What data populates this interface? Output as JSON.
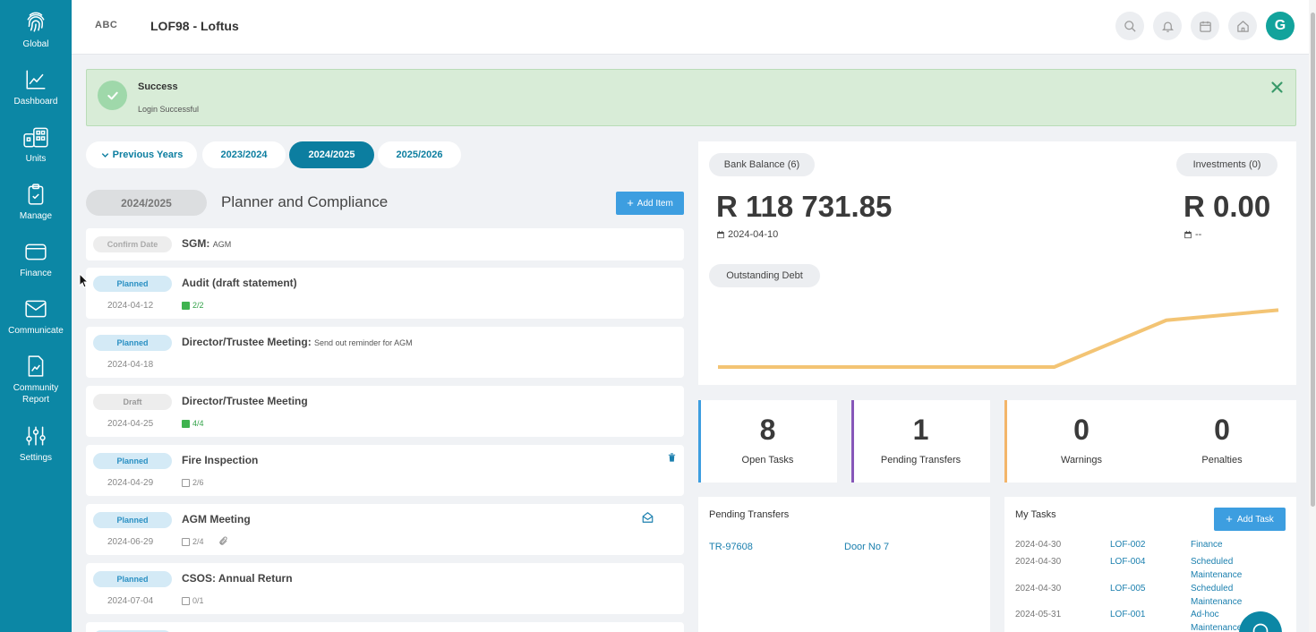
{
  "sidebar": {
    "items": [
      {
        "label": "Global",
        "icon": "fingerprint-icon"
      },
      {
        "label": "Dashboard",
        "icon": "chart-line-icon"
      },
      {
        "label": "Units",
        "icon": "buildings-icon"
      },
      {
        "label": "Manage",
        "icon": "clipboard-check-icon"
      },
      {
        "label": "Finance",
        "icon": "wallet-icon"
      },
      {
        "label": "Communicate",
        "icon": "envelope-icon"
      },
      {
        "label": "Community",
        "label2": "Report",
        "icon": "report-icon"
      },
      {
        "label": "Settings",
        "icon": "sliders-icon"
      }
    ]
  },
  "header": {
    "logo": "ABC",
    "title": "LOF98 - Loftus",
    "avatar_initial": "G",
    "accent": "#0c87a5"
  },
  "alert": {
    "title": "Success",
    "message": "Login Successful"
  },
  "year_tabs": [
    {
      "label": "Previous Years"
    },
    {
      "label": "2023/2024"
    },
    {
      "label": "2024/2025",
      "active": true
    },
    {
      "label": "2025/2026"
    }
  ],
  "planner": {
    "year": "2024/2025",
    "title": "Planner and Compliance",
    "add_label": "Add Item",
    "items": [
      {
        "status": "Confirm Date",
        "title": "SGM:",
        "subtitle": "AGM",
        "date": "",
        "check": ""
      },
      {
        "status": "Planned",
        "title": "Audit (draft statement)",
        "subtitle": "",
        "date": "2024-04-12",
        "check": "2/2",
        "done": true
      },
      {
        "status": "Planned",
        "title": "Director/Trustee Meeting:",
        "subtitle": "Send out reminder for AGM",
        "date": "2024-04-18",
        "check": ""
      },
      {
        "status": "Draft",
        "title": "Director/Trustee Meeting",
        "subtitle": "",
        "date": "2024-04-25",
        "check": "4/4",
        "done": true
      },
      {
        "status": "Planned",
        "title": "Fire Inspection",
        "subtitle": "",
        "date": "2024-04-29",
        "check": "2/6"
      },
      {
        "status": "Planned",
        "title": "AGM Meeting",
        "subtitle": "",
        "date": "2024-06-29",
        "check": "2/4"
      },
      {
        "status": "Planned",
        "title": "CSOS: Annual Return",
        "subtitle": "",
        "date": "2024-07-04",
        "check": "0/1"
      }
    ]
  },
  "finance": {
    "bank_label": "Bank Balance (6)",
    "bank_amount": "R 118 731.85",
    "bank_date": "2024-04-10",
    "inv_label": "Investments (0)",
    "inv_amount": "R 0.00",
    "inv_date": "--",
    "debt_label": "Outstanding Debt",
    "debt_trend": [
      0,
      0,
      0,
      0,
      0.55,
      0.67
    ],
    "line_color": "#f3c474"
  },
  "stats": [
    {
      "value": "8",
      "label": "Open Tasks",
      "color": "#3d9ee0"
    },
    {
      "value": "1",
      "label": "Pending Transfers",
      "color": "#8757b9"
    },
    {
      "value": "0",
      "label": "Warnings",
      "color": "#f3b56a"
    },
    {
      "value": "0",
      "label": "Penalties"
    }
  ],
  "pending_transfers": {
    "title": "Pending Transfers",
    "rows": [
      {
        "ref": "TR-97608",
        "unit": "Door No 7"
      }
    ]
  },
  "my_tasks": {
    "title": "My Tasks",
    "add_label": "Add Task",
    "rows": [
      {
        "date": "2024-04-30",
        "id": "LOF-002",
        "cat1": "Finance",
        "cat2": ""
      },
      {
        "date": "2024-04-30",
        "id": "LOF-004",
        "cat1": "Scheduled",
        "cat2": "Maintenance"
      },
      {
        "date": "2024-04-30",
        "id": "LOF-005",
        "cat1": "Scheduled",
        "cat2": "Maintenance"
      },
      {
        "date": "2024-05-31",
        "id": "LOF-001",
        "cat1": "Ad-hoc",
        "cat2": "Maintenance"
      }
    ]
  }
}
